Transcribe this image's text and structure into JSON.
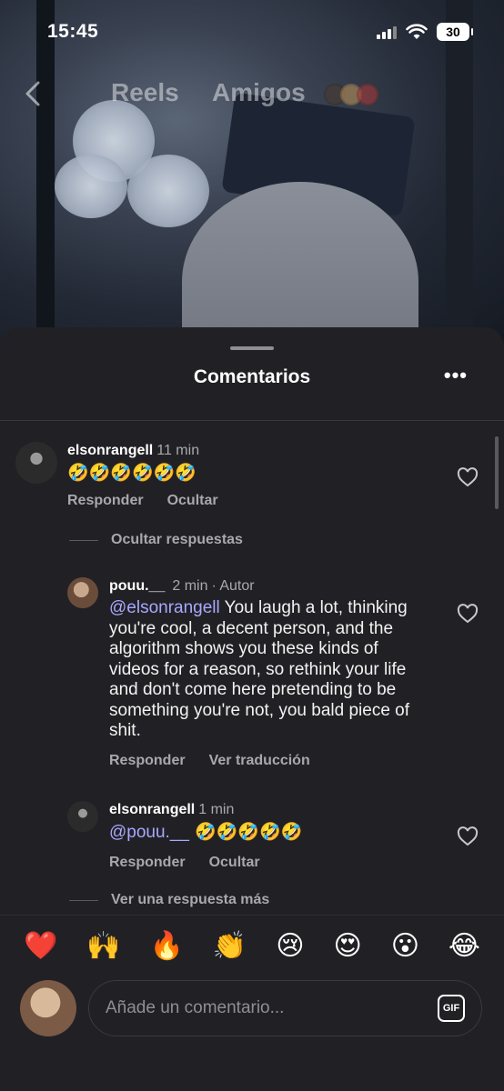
{
  "status_bar": {
    "time": "15:45",
    "battery": "30"
  },
  "reel_nav": {
    "back_icon": "chevron-left-icon",
    "tabs": [
      "Reels",
      "Amigos"
    ],
    "friend_avatar_colors": [
      "#4a3a32",
      "#b7925a",
      "#a33a3a"
    ]
  },
  "sheet": {
    "title": "Comentarios",
    "more_icon": "more-horizontal-icon"
  },
  "comments": [
    {
      "username": "elsonrangell",
      "time": "11 min",
      "text": "🤣🤣🤣🤣🤣🤣",
      "actions": [
        "Responder",
        "Ocultar"
      ]
    }
  ],
  "thread_toggle_top": "Ocultar respuestas",
  "replies": [
    {
      "username": "pouu.__",
      "time": "2 min",
      "badge": "· Autor",
      "mention": "@elsonrangell",
      "text": " You laugh a lot, thinking you're cool, a decent person, and the algorithm shows you these kinds of videos for a reason, so rethink your life and don't come here pretending to be something you're not, you bald piece of shit.",
      "actions": [
        "Responder",
        "Ver traducción"
      ]
    },
    {
      "username": "elsonrangell",
      "time": "1 min",
      "mention": "@pouu.__",
      "text": " 🤣🤣🤣🤣🤣",
      "actions": [
        "Responder",
        "Ocultar"
      ]
    }
  ],
  "thread_toggle_bottom": "Ver una respuesta más",
  "reactions": [
    "❤️",
    "🙌",
    "🔥",
    "👏",
    "😢",
    "😍",
    "😮",
    "😂"
  ],
  "input": {
    "placeholder": "Añade un comentario...",
    "gif_label": "GIF"
  }
}
